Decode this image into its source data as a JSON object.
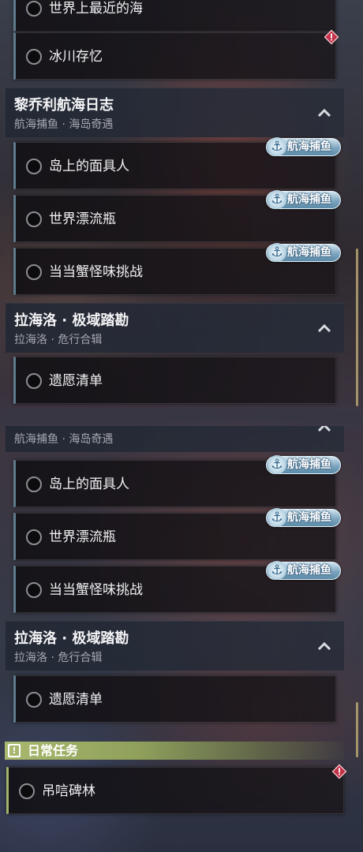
{
  "colors": {
    "task_accent": "#5f7b8c",
    "daily_accent": "#a3b56a",
    "badge_fill": "#7fa6bf",
    "alert": "#c2334a"
  },
  "top_panel": {
    "tasks_a": [
      {
        "label": "世界上最近的海"
      },
      {
        "label": "冰川存忆",
        "icon": "alert-diamond-icon"
      }
    ],
    "group1": {
      "title": "黎乔利航海日志",
      "subtitle": "航海捕鱼 · 海岛奇遇"
    },
    "tasks_b": [
      {
        "label": "岛上的面具人",
        "badge": "航海捕鱼"
      },
      {
        "label": "世界漂流瓶",
        "badge": "航海捕鱼"
      },
      {
        "label": "当当蟹怪味挑战",
        "badge": "航海捕鱼"
      }
    ],
    "group2": {
      "title": "拉海洛 · 极域踏勘",
      "subtitle": "拉海洛 · 危行合辑"
    },
    "tasks_c": [
      {
        "label": "遗愿清单"
      }
    ]
  },
  "bottom_panel": {
    "group1": {
      "subtitle": "航海捕鱼 · 海岛奇遇"
    },
    "tasks_b": [
      {
        "label": "岛上的面具人",
        "badge": "航海捕鱼"
      },
      {
        "label": "世界漂流瓶",
        "badge": "航海捕鱼"
      },
      {
        "label": "当当蟹怪味挑战",
        "badge": "航海捕鱼"
      }
    ],
    "group2": {
      "title": "拉海洛 · 极域踏勘",
      "subtitle": "拉海洛 · 危行合辑"
    },
    "tasks_c": [
      {
        "label": "遗愿清单"
      }
    ],
    "daily": {
      "header": "日常任务",
      "tasks": [
        {
          "label": "吊唁碑林",
          "icon": "alert-diamond-icon"
        }
      ]
    }
  }
}
